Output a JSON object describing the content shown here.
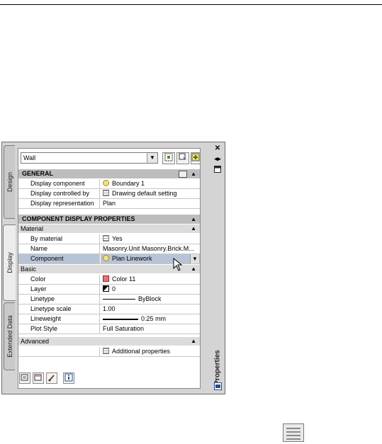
{
  "palette": {
    "title": "Properties",
    "tabs": [
      "Design",
      "Display",
      "Extended Data"
    ],
    "active_tab": "Display",
    "object_type": "Wall",
    "sections": {
      "general": {
        "title": "GENERAL",
        "rows": [
          {
            "key": "Display component",
            "value": "Boundary 1",
            "icon": "lightbulb-icon"
          },
          {
            "key": "Display controlled by",
            "value": "Drawing default setting",
            "icon": "display-settings-icon"
          },
          {
            "key": "Display representation",
            "value": "Plan"
          }
        ]
      },
      "component": {
        "title": "COMPONENT DISPLAY PROPERTIES",
        "material": {
          "title": "Material",
          "rows": [
            {
              "key": "By material",
              "value": "Yes",
              "icon": "material-icon"
            },
            {
              "key": "Name",
              "value": "Masonry.Unit Masonry.Brick.M..."
            },
            {
              "key": "Component",
              "value": "Plan Linework",
              "icon": "lightbulb-icon",
              "selected": true
            }
          ]
        },
        "basic": {
          "title": "Basic",
          "rows": [
            {
              "key": "Color",
              "value": "Color 11",
              "icon": "color-swatch-icon"
            },
            {
              "key": "Layer",
              "value": "0",
              "icon": "layer-icon"
            },
            {
              "key": "Linetype",
              "value": "ByBlock"
            },
            {
              "key": "Linetype scale",
              "value": "1.00"
            },
            {
              "key": "Lineweight",
              "value": "0.25 mm"
            },
            {
              "key": "Plot Style",
              "value": "Full Saturation"
            }
          ]
        },
        "advanced": {
          "title": "Advanced",
          "rows": [
            {
              "key": "",
              "value": "Additional properties",
              "icon": "table-icon"
            }
          ]
        }
      }
    }
  },
  "colors": {
    "selected_row": "#b7c4d8",
    "section_header": "#bdbdbd",
    "color_11": "#ee7070"
  }
}
